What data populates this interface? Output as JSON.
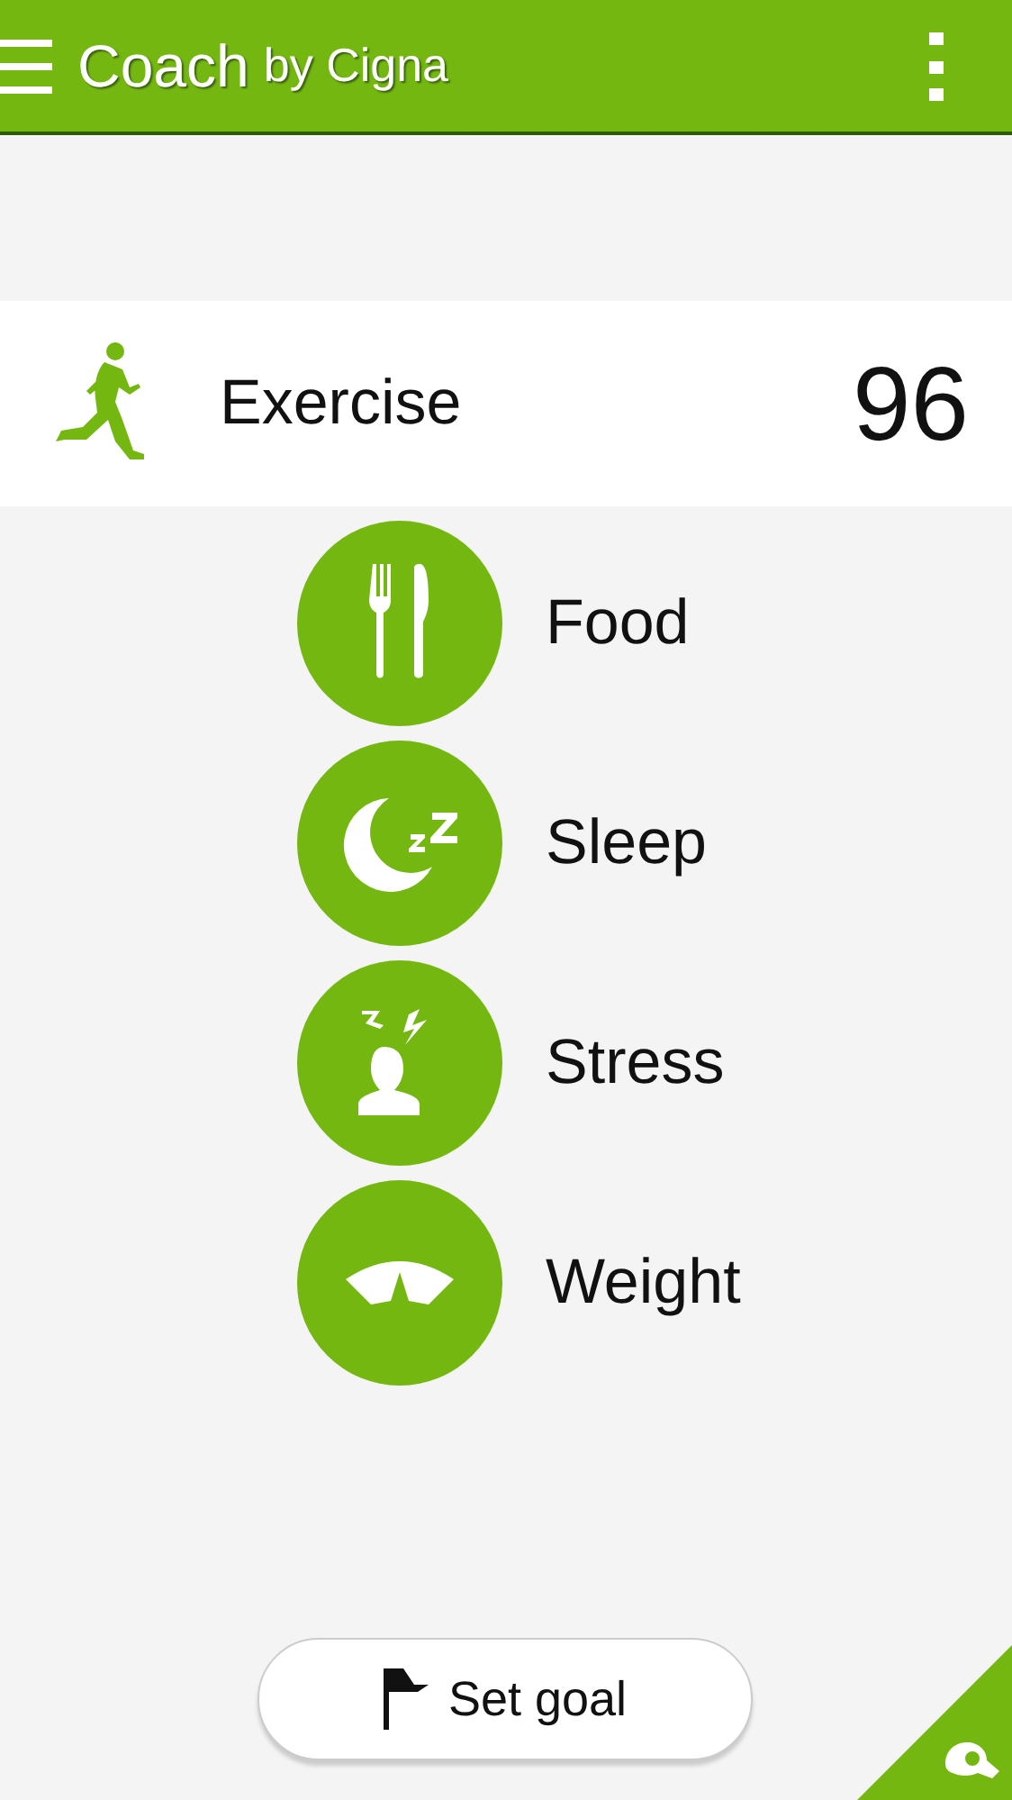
{
  "app_bar": {
    "title": "Coach",
    "subtitle": "by Cigna"
  },
  "categories": [
    {
      "label": "Exercise",
      "selected": true,
      "score": "96"
    },
    {
      "label": "Food",
      "selected": false
    },
    {
      "label": "Sleep",
      "selected": false
    },
    {
      "label": "Stress",
      "selected": false
    },
    {
      "label": "Weight",
      "selected": false
    }
  ],
  "set_goal_button": {
    "label": "Set goal"
  }
}
